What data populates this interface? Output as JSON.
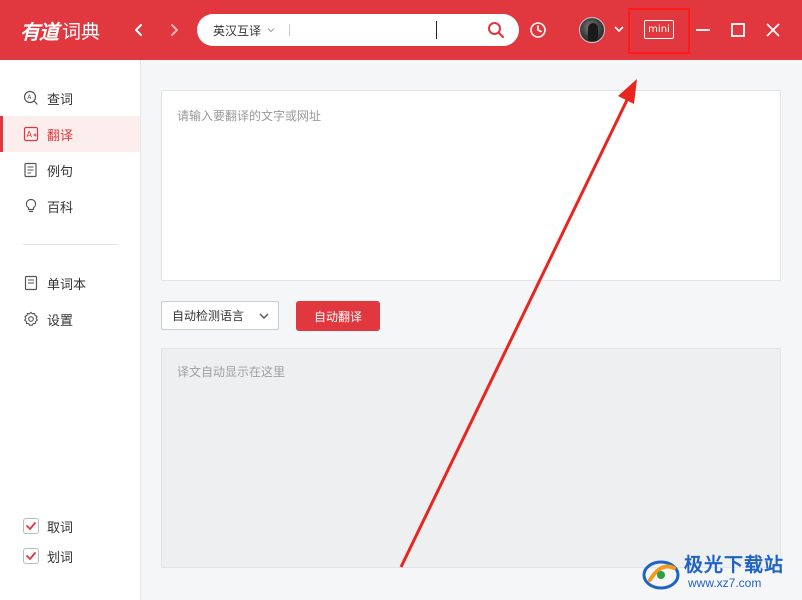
{
  "app": {
    "logo_mark": "有道",
    "logo_text": "词典"
  },
  "search": {
    "language_mode": "英汉互译",
    "value": ""
  },
  "window_controls": {
    "mini_label": "mini"
  },
  "sidebar": {
    "items": [
      {
        "label": "查词",
        "icon": "lookup-icon"
      },
      {
        "label": "翻译",
        "icon": "translate-icon",
        "active": true
      },
      {
        "label": "例句",
        "icon": "sentence-icon"
      },
      {
        "label": "百科",
        "icon": "bulb-icon"
      },
      {
        "label": "单词本",
        "icon": "wordbook-icon"
      },
      {
        "label": "设置",
        "icon": "gear-icon"
      }
    ],
    "toggles": [
      {
        "label": "取词",
        "checked": true
      },
      {
        "label": "划词",
        "checked": true
      }
    ]
  },
  "translate": {
    "input_placeholder": "请输入要翻译的文字或网址",
    "source_language": "自动检测语言",
    "translate_button": "自动翻译",
    "output_placeholder": "译文自动显示在这里"
  },
  "colors": {
    "brand": "#e0383e",
    "highlight_box": "#ff1a1a",
    "annotation_arrow": "#e8261f",
    "watermark": "#1e63c4"
  },
  "watermark": {
    "title": "极光下载站",
    "url": "www.xz7.com"
  }
}
